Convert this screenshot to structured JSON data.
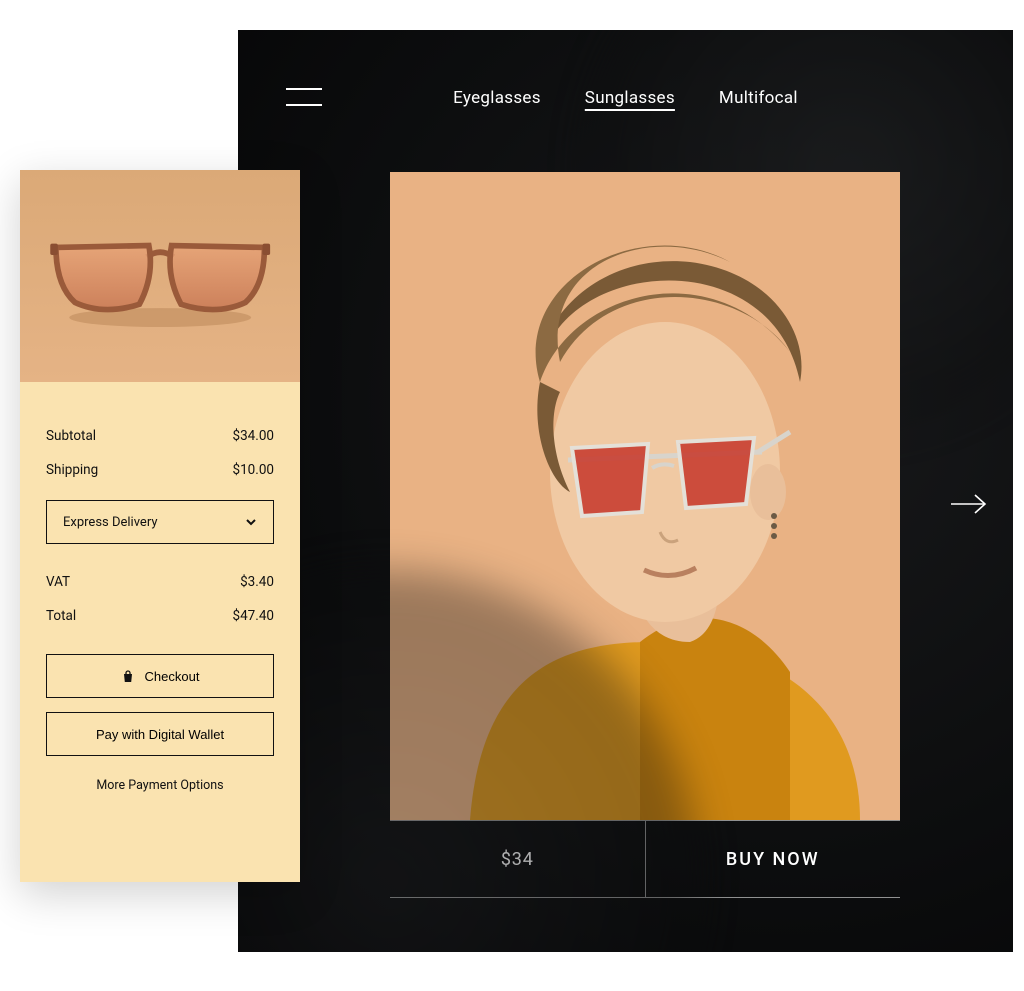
{
  "nav": {
    "items": [
      {
        "label": "Eyeglasses",
        "active": false
      },
      {
        "label": "Sunglasses",
        "active": true
      },
      {
        "label": "Multifocal",
        "active": false
      }
    ]
  },
  "product": {
    "price_label": "$34",
    "buy_label": "BUY NOW"
  },
  "cart": {
    "subtotal_label": "Subtotal",
    "subtotal_value": "$34.00",
    "shipping_label": "Shipping",
    "shipping_value": "$10.00",
    "delivery_option": "Express Delivery",
    "vat_label": "VAT",
    "vat_value": "$3.40",
    "total_label": "Total",
    "total_value": "$47.40",
    "checkout_label": "Checkout",
    "wallet_label": "Pay with Digital Wallet",
    "more_label": "More Payment Options"
  }
}
